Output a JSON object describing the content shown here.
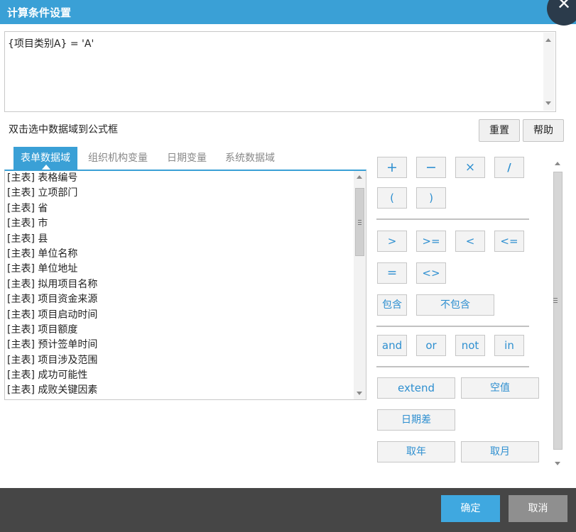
{
  "window": {
    "title": "计算条件设置",
    "close_symbol": "✕"
  },
  "formula": {
    "value": "{项目类别A} = 'A'"
  },
  "hint": "双击选中数据域到公式框",
  "top_buttons": {
    "reset": "重置",
    "help": "帮助"
  },
  "tabs": [
    {
      "label": "表单数据域",
      "active": true
    },
    {
      "label": "组织机构变量",
      "active": false
    },
    {
      "label": "日期变量",
      "active": false
    },
    {
      "label": "系统数据域",
      "active": false
    }
  ],
  "fields": [
    "[主表] 表格编号",
    "[主表] 立项部门",
    "[主表] 省",
    "[主表] 市",
    "[主表] 县",
    "[主表] 单位名称",
    "[主表] 单位地址",
    "[主表] 拟用项目名称",
    "[主表] 项目资金来源",
    "[主表] 项目启动时间",
    "[主表] 项目额度",
    "[主表] 预计签单时间",
    "[主表] 项目涉及范围",
    "[主表] 成功可能性",
    "[主表] 成败关键因素"
  ],
  "operators": {
    "plus": "+",
    "minus": "−",
    "times": "×",
    "divide": "/",
    "lparen": "(",
    "rparen": ")",
    "gt": ">",
    "ge": ">=",
    "lt": "<",
    "le": "<=",
    "eq": "=",
    "ne": "<>",
    "contains": "包含",
    "not_contains": "不包含",
    "and": "and",
    "or": "or",
    "not": "not",
    "in": "in"
  },
  "functions": {
    "extend": "extend",
    "null": "空值",
    "date_diff": "日期差",
    "year": "取年",
    "month": "取月"
  },
  "footer": {
    "ok": "确定",
    "cancel": "取消"
  },
  "colors": {
    "accent": "#3aa0d6",
    "footer": "#464646",
    "ok": "#3fa8e0",
    "cancel": "#8f8f8f"
  }
}
